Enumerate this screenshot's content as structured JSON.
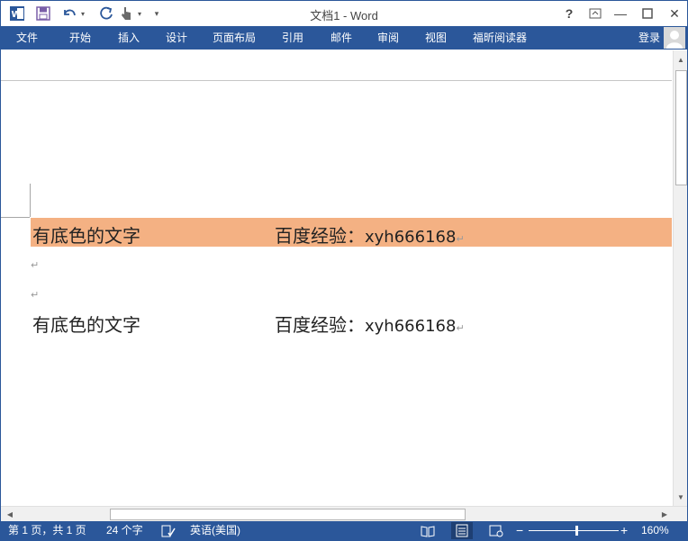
{
  "window": {
    "title": "文档1 - Word",
    "buttons": {
      "help": "?",
      "minimize": "—",
      "close": "✕"
    }
  },
  "quick_access": {
    "customize": "▾"
  },
  "ribbon_tabs": [
    {
      "label": "文件",
      "name": "tab-file"
    },
    {
      "label": "开始",
      "name": "tab-home"
    },
    {
      "label": "插入",
      "name": "tab-insert"
    },
    {
      "label": "设计",
      "name": "tab-design"
    },
    {
      "label": "页面布局",
      "name": "tab-page-layout"
    },
    {
      "label": "引用",
      "name": "tab-references"
    },
    {
      "label": "邮件",
      "name": "tab-mailings"
    },
    {
      "label": "审阅",
      "name": "tab-review"
    },
    {
      "label": "视图",
      "name": "tab-view"
    },
    {
      "label": "福昕阅读器",
      "name": "tab-foxit-reader"
    }
  ],
  "account": {
    "signin": "登录"
  },
  "document": {
    "line1": {
      "left": "有底色的文字",
      "right_prefix": "百度经验：",
      "right_value": "xyh666168",
      "shading": "#f4b183"
    },
    "line2": {
      "left": "有底色的文字",
      "right_prefix": "百度经验：",
      "right_value": "xyh666168"
    },
    "paragraph_mark": "↵"
  },
  "status": {
    "page": "第 1 页，共 1 页",
    "words": "24 个字",
    "language": "英语(美国)",
    "zoom_minus": "−",
    "zoom_plus": "+",
    "zoom": "160%",
    "zoom_level_percent": 160
  },
  "colors": {
    "accent": "#2b579a",
    "shading": "#f4b183"
  }
}
